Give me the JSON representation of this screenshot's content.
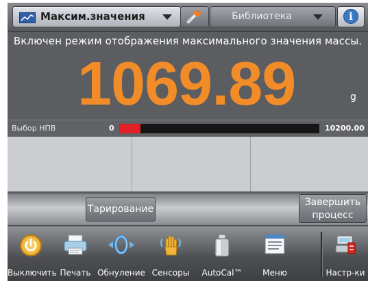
{
  "topbar": {
    "mode_label": "Максим.значения",
    "library_label": "Библиотека",
    "info_glyph": "i"
  },
  "status_message": "Включен режим отображения максимального значения массы.",
  "reading": {
    "value": "1069.89",
    "unit": "g"
  },
  "capacity": {
    "label": "Выбор НПВ",
    "min": "0",
    "max": "10200.00",
    "fill_fraction": 0.105
  },
  "actions": {
    "tare": "Тарирование",
    "finish_line1": "Завершить",
    "finish_line2": "процесс"
  },
  "toolbar": {
    "items": [
      {
        "label": "Выключить",
        "icon": "power-icon"
      },
      {
        "label": "Печать",
        "icon": "printer-icon"
      },
      {
        "label": "Обнуление",
        "icon": "zero-icon"
      },
      {
        "label": "Сенсоры",
        "icon": "hand-sensor-icon"
      },
      {
        "label": "AutoCal™",
        "icon": "calibration-weight-icon"
      },
      {
        "label": "Меню",
        "icon": "menu-icon"
      },
      {
        "label": "Настр-ки",
        "icon": "settings-icon"
      }
    ]
  },
  "colors": {
    "weight": "#f28c28",
    "capacity_fill": "#e21e26"
  }
}
